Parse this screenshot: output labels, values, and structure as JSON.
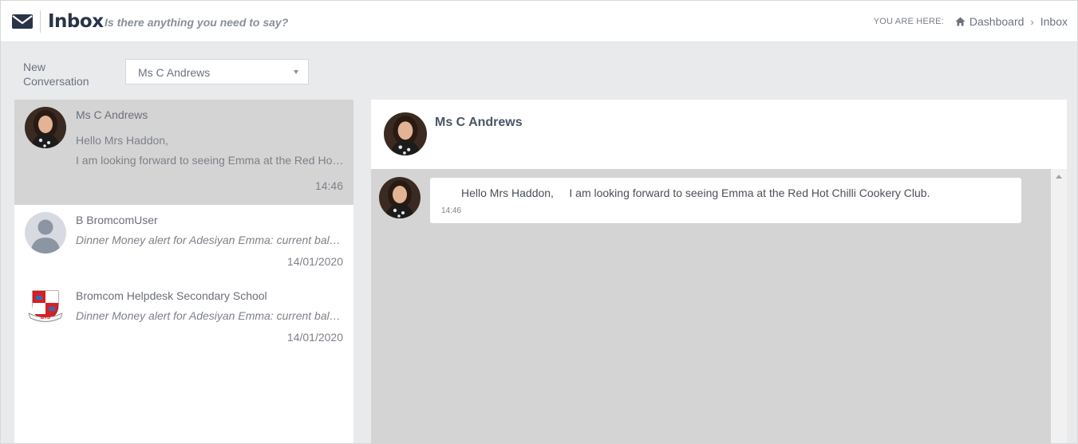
{
  "header": {
    "title": "Inbox",
    "subtitle": "Is there anything you need to say?",
    "breadcrumb_prefix": "YOU ARE HERE:",
    "breadcrumb_home": "Dashboard",
    "breadcrumb_separator": "›",
    "breadcrumb_current": "Inbox"
  },
  "new_conversation": {
    "label": "New Conversation",
    "selected": "Ms C Andrews"
  },
  "conversations": [
    {
      "name": "Ms C Andrews",
      "line1": "Hello Mrs Haddon,",
      "line2": "I am looking forward to seeing Emma at the Red Hot Chilli Cookery Club.",
      "time": "14:46",
      "avatar": "portrait-photo-icon",
      "active": true
    },
    {
      "name": "B BromcomUser",
      "line1": "Dinner Money alert for Adesiyan Emma: current balance",
      "time": "14/01/2020",
      "avatar": "default-user-icon",
      "active": false
    },
    {
      "name": "Bromcom Helpdesk Secondary School",
      "line1": "Dinner Money alert for Adesiyan Emma: current balance",
      "time": "14/01/2020",
      "avatar": "school-crest-icon",
      "active": false
    }
  ],
  "chat": {
    "contact_name": "Ms C Andrews",
    "messages": [
      {
        "text": "Hello Mrs Haddon,     I am looking forward to seeing Emma at the Red Hot Chilli Cookery Club.",
        "time": "14:46"
      }
    ]
  },
  "crest_text": "BTS",
  "colors": {
    "title": "#2a3448",
    "active_row": "#d4d4d4",
    "background": "#e9eaec",
    "crest_red": "#d62024"
  }
}
